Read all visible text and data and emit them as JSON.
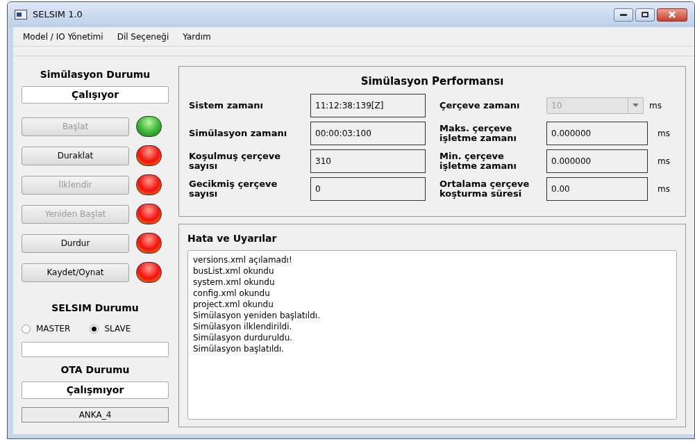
{
  "window": {
    "title": "SELSIM 1.0"
  },
  "menu": [
    "Model / IO Yönetimi",
    "Dil Seçeneği",
    "Yardım"
  ],
  "simulation_status": {
    "heading": "Simülasyon Durumu",
    "value": "Çalışıyor"
  },
  "controls": [
    {
      "label": "Başlat",
      "disabled": true,
      "lamp_on": true
    },
    {
      "label": "Duraklat",
      "disabled": false,
      "lamp_on": false
    },
    {
      "label": "İlklendir",
      "disabled": true,
      "lamp_on": false
    },
    {
      "label": "Yeniden Başlat",
      "disabled": true,
      "lamp_on": false
    },
    {
      "label": "Durdur",
      "disabled": false,
      "lamp_on": false
    },
    {
      "label": "Kaydet/Oynat",
      "disabled": false,
      "lamp_on": false
    }
  ],
  "selsim_status": {
    "heading": "SELSIM Durumu",
    "modes": [
      {
        "label": "MASTER",
        "selected": false
      },
      {
        "label": "SLAVE",
        "selected": true
      }
    ]
  },
  "ota_status": {
    "heading": "OTA Durumu",
    "value": "Çalışmıyor",
    "name": "ANKA_4"
  },
  "performance": {
    "title": "Simülasyon Performansı",
    "left": [
      {
        "label": "Sistem zamanı",
        "value": "11:12:38:139[Z]"
      },
      {
        "label": "Simülasyon zamanı",
        "value": "00:00:03:100"
      },
      {
        "label": "Koşulmuş çerçeve sayısı",
        "value": "310"
      },
      {
        "label": "Gecikmiş çerçeve sayısı",
        "value": "0"
      }
    ],
    "right": [
      {
        "kind": "combo",
        "label": "Çerçeve zamanı",
        "value": "10",
        "unit": "ms"
      },
      {
        "kind": "field",
        "label": "Maks. çerçeve işletme zamanı",
        "value": "0.000000",
        "unit": "ms"
      },
      {
        "kind": "field",
        "label": "Min. çerçeve işletme zamanı",
        "value": "0.000000",
        "unit": "ms"
      },
      {
        "kind": "field",
        "label": "Ortalama çerçeve koşturma süresi",
        "value": "0.00",
        "unit": "ms"
      }
    ]
  },
  "log": {
    "title": "Hata ve Uyarılar",
    "lines": [
      "versions.xml açılamadı!",
      "busList.xml okundu",
      "system.xml okundu",
      "config.xml okundu",
      "project.xml okundu",
      "Simülasyon yeniden başlatıldı.",
      "Simülasyon ilklendirildi.",
      "Simülasyon durduruldu.",
      "Simülasyon başlatıldı."
    ]
  }
}
